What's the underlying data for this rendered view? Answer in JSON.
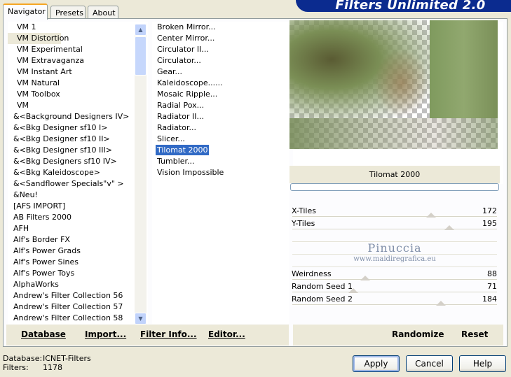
{
  "tabs": [
    {
      "label": "Navigator",
      "active": true
    },
    {
      "label": "Presets",
      "active": false
    },
    {
      "label": "About",
      "active": false
    }
  ],
  "banner": "Filters Unlimited 2.0",
  "categories": {
    "items": [
      "VM 1",
      "VM Distortion",
      "VM Experimental",
      "VM Extravaganza",
      "VM Instant Art",
      "VM Natural",
      "VM Toolbox",
      "VM",
      "&<Background Designers IV>",
      "&<Bkg Designer sf10 I>",
      "&<Bkg Designer sf10 II>",
      "&<Bkg Designer sf10 III>",
      "&<Bkg Designers sf10 IV>",
      "&<Bkg Kaleidoscope>",
      "&<Sandflower Specials\"v\" >",
      "&Neu!",
      "[AFS IMPORT]",
      "AB Filters 2000",
      "AFH",
      "Alf's Border FX",
      "Alf's Power Grads",
      "Alf's Power Sines",
      "Alf's Power Toys",
      "AlphaWorks",
      "Andrew's Filter Collection 56",
      "Andrew's Filter Collection 57",
      "Andrew's Filter Collection 58"
    ],
    "selected_index": 1
  },
  "filters": {
    "items": [
      "Broken Mirror...",
      "Center Mirror...",
      "Circulator II...",
      "Circulator...",
      "Gear...",
      "Kaleidoscope......",
      "Mosaic Ripple...",
      "Radial Pox...",
      "Radiator II...",
      "Radiator...",
      "Slicer...",
      "Tilomat 2000",
      "Tumbler...",
      "Vision Impossible"
    ],
    "selected_index": 11
  },
  "filter_name": "Tilomat 2000",
  "params": [
    {
      "label": "X-Tiles",
      "value": "172",
      "level": 0.67
    },
    {
      "label": "Y-Tiles",
      "value": "195",
      "level": 0.76
    },
    {
      "label": "",
      "value": "",
      "level": null
    },
    {
      "label": "",
      "value": "",
      "level": null
    },
    {
      "label": "",
      "value": "",
      "level": null
    },
    {
      "label": "Weirdness",
      "value": "88",
      "level": 0.34
    },
    {
      "label": "Random Seed 1",
      "value": "71",
      "level": 0.28
    },
    {
      "label": "Random Seed 2",
      "value": "184",
      "level": 0.72
    }
  ],
  "watermark": {
    "line1": "Pinuccia",
    "line2": "www.maidiregrafica.eu"
  },
  "bottom_links": {
    "database": "Database",
    "import": "Import...",
    "filter_info": "Filter Info...",
    "editor": "Editor...",
    "randomize": "Randomize",
    "reset": "Reset"
  },
  "status": {
    "database_label": "Database:",
    "database_value": "ICNET-Filters",
    "filters_label": "Filters:",
    "filters_value": "1178"
  },
  "buttons": {
    "apply": "Apply",
    "cancel": "Cancel",
    "help": "Help"
  }
}
